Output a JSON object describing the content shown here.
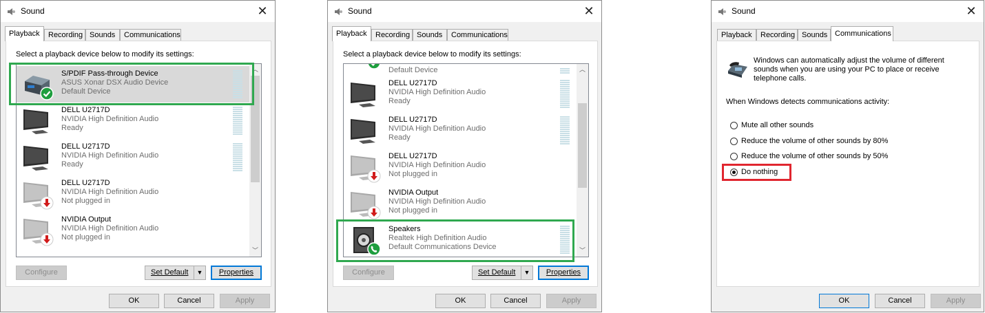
{
  "dialogs": [
    {
      "title": "Sound",
      "close_glyph": "✕",
      "tabs": [
        "Playback",
        "Recording",
        "Sounds",
        "Communications"
      ],
      "active_tab": "Playback",
      "instruction": "Select a playback device below to modify its settings:",
      "devices": [
        {
          "name": "S/PDIF Pass-through Device",
          "driver": "ASUS Xonar DSX Audio Device",
          "status": "Default Device",
          "icon": "spdif-device-icon",
          "badge": "green-check-icon",
          "selected": true
        },
        {
          "name": "DELL U2717D",
          "driver": "NVIDIA High Definition Audio",
          "status": "Ready",
          "icon": "monitor-icon",
          "badge": ""
        },
        {
          "name": "DELL U2717D",
          "driver": "NVIDIA High Definition Audio",
          "status": "Ready",
          "icon": "monitor-icon",
          "badge": ""
        },
        {
          "name": "DELL U2717D",
          "driver": "NVIDIA High Definition Audio",
          "status": "Not plugged in",
          "icon": "monitor-disabled-icon",
          "badge": "red-down-arrow-icon"
        },
        {
          "name": "NVIDIA Output",
          "driver": "NVIDIA High Definition Audio",
          "status": "Not plugged in",
          "icon": "monitor-disabled-icon",
          "badge": "red-down-arrow-icon"
        }
      ],
      "buttons": {
        "configure": "Configure",
        "set_default": "Set Default",
        "properties": "Properties",
        "ok": "OK",
        "cancel": "Cancel",
        "apply": "Apply"
      }
    },
    {
      "title": "Sound",
      "close_glyph": "✕",
      "tabs": [
        "Playback",
        "Recording",
        "Sounds",
        "Communications"
      ],
      "active_tab": "Playback",
      "instruction": "Select a playback device below to modify its settings:",
      "devices": [
        {
          "name": "",
          "driver": "Default Device",
          "status": "",
          "icon": "spdif-device-icon",
          "badge": "green-check-icon"
        },
        {
          "name": "DELL U2717D",
          "driver": "NVIDIA High Definition Audio",
          "status": "Ready",
          "icon": "monitor-icon",
          "badge": ""
        },
        {
          "name": "DELL U2717D",
          "driver": "NVIDIA High Definition Audio",
          "status": "Ready",
          "icon": "monitor-icon",
          "badge": ""
        },
        {
          "name": "DELL U2717D",
          "driver": "NVIDIA High Definition Audio",
          "status": "Not plugged in",
          "icon": "monitor-disabled-icon",
          "badge": "red-down-arrow-icon"
        },
        {
          "name": "NVIDIA Output",
          "driver": "NVIDIA High Definition Audio",
          "status": "Not plugged in",
          "icon": "monitor-disabled-icon",
          "badge": "red-down-arrow-icon"
        },
        {
          "name": "Speakers",
          "driver": "Realtek High Definition Audio",
          "status": "Default Communications Device",
          "icon": "speaker-icon",
          "badge": "green-phone-icon"
        }
      ],
      "buttons": {
        "configure": "Configure",
        "set_default": "Set Default",
        "properties": "Properties",
        "ok": "OK",
        "cancel": "Cancel",
        "apply": "Apply"
      }
    },
    {
      "title": "Sound",
      "close_glyph": "✕",
      "tabs": [
        "Playback",
        "Recording",
        "Sounds",
        "Communications"
      ],
      "active_tab": "Communications",
      "info_text_lines": [
        "Windows can automatically adjust the volume of different",
        "sounds when you are using your PC to place or receive",
        "telephone calls."
      ],
      "detect_label": "When Windows detects communications activity:",
      "options": [
        {
          "label": "Mute all other sounds",
          "checked": false
        },
        {
          "label": "Reduce the volume of other sounds by 80%",
          "checked": false
        },
        {
          "label": "Reduce the volume of other sounds by 50%",
          "checked": false
        },
        {
          "label": "Do nothing",
          "checked": true
        }
      ],
      "buttons": {
        "ok": "OK",
        "cancel": "Cancel",
        "apply": "Apply"
      }
    }
  ],
  "colors": {
    "highlight_green": "#2fa84f",
    "highlight_red": "#e0262f",
    "focus_blue": "#0078d7"
  }
}
